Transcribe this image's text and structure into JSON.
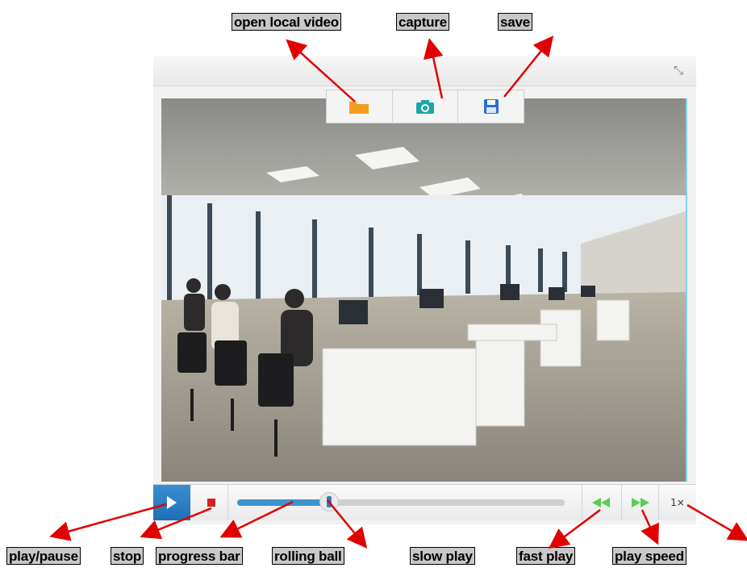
{
  "callouts": {
    "open_local_video": "open local video",
    "capture": "capture",
    "save": "save",
    "play_pause": "play/pause",
    "stop": "stop",
    "progress_bar": "progress bar",
    "rolling_ball": "rolling ball",
    "slow_play": "slow play",
    "fast_play": "fast play",
    "play_speed": "play speed"
  },
  "toolbar": {
    "open_icon": "folder-icon",
    "capture_icon": "camera-icon",
    "save_icon": "floppy-disk-icon"
  },
  "controls": {
    "play_icon": "play-icon",
    "stop_icon": "stop-icon",
    "slow_icon": "rewind-icon",
    "fast_icon": "fast-forward-icon",
    "speed": "1×",
    "progress_fraction": 0.28
  },
  "colors": {
    "accent": "#2b7dc2",
    "stop": "#d42020",
    "speed_arrows": "#5ccc55",
    "arrow": "#e00000",
    "folder": "#f0a020",
    "camera": "#1fa6a6",
    "floppy": "#2b6fd1"
  }
}
